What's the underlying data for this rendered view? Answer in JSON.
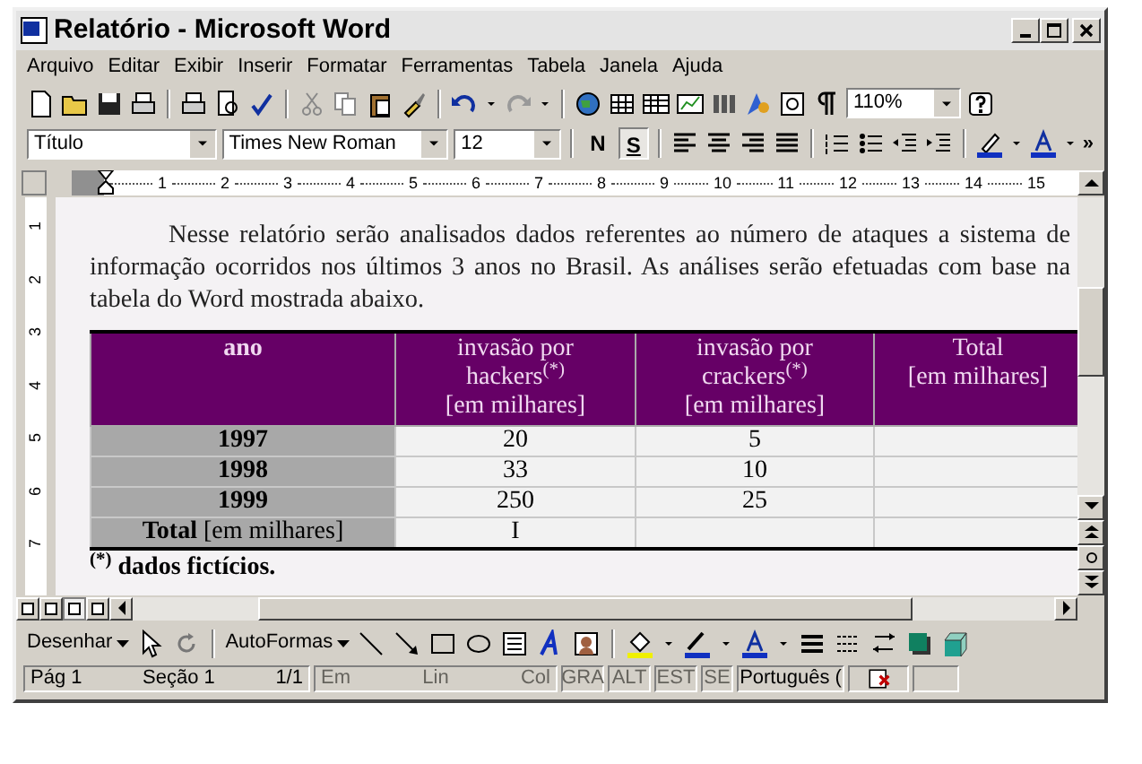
{
  "window": {
    "title": "Relatório - Microsoft Word"
  },
  "menu": [
    "Arquivo",
    "Editar",
    "Exibir",
    "Inserir",
    "Formatar",
    "Ferramentas",
    "Tabela",
    "Janela",
    "Ajuda"
  ],
  "standard_toolbar": {
    "zoom": "110%"
  },
  "formatting_toolbar": {
    "style": "Título",
    "font": "Times New Roman",
    "size": "12",
    "bold": "N",
    "underline": "S",
    "more": "»"
  },
  "ruler": {
    "marks": [
      "1",
      "2",
      "3",
      "4",
      "5",
      "6",
      "7",
      "8",
      "9",
      "10",
      "11",
      "12",
      "13",
      "14",
      "15"
    ]
  },
  "vertical_ruler": {
    "marks": [
      "1",
      "2",
      "3",
      "4",
      "5",
      "6",
      "7"
    ]
  },
  "document": {
    "paragraph": "Nesse relatório serão analisados dados referentes ao número de ataques a sistema de informação ocorridos nos últimos 3 anos no Brasil. As análises serão efetuadas com base na tabela do Word mostrada abaixo.",
    "table": {
      "columns": [
        "ano",
        "invasão por\nhackers$^{(*)}$\n[em milhares]",
        "invasão por\ncrackers$^{(*)}$\n[em milhares]",
        "Total\n[em milhares]"
      ],
      "rows": [
        [
          "1997",
          "20",
          "5",
          ""
        ],
        [
          "1998",
          "33",
          "10",
          ""
        ],
        [
          "1999",
          "250",
          "25",
          ""
        ],
        [
          "**Total** [em milhares]",
          "I",
          "",
          ""
        ]
      ]
    },
    "footnote": "$^{(*)}$ dados fictícios."
  },
  "drawing_toolbar": {
    "draw": "Desenhar",
    "autoshapes": "AutoFormas"
  },
  "status_bar": [
    {
      "text": "Pág 1",
      "disabled": false
    },
    {
      "text": "Seção 1",
      "disabled": false
    },
    {
      "text": "1/1",
      "disabled": false
    },
    {
      "text": "Em",
      "disabled": true
    },
    {
      "text": "Lin",
      "disabled": true
    },
    {
      "text": "Col",
      "disabled": true
    },
    {
      "text": "GRA",
      "disabled": true
    },
    {
      "text": "ALT",
      "disabled": true
    },
    {
      "text": "EST",
      "disabled": true
    },
    {
      "text": "SE",
      "disabled": true
    },
    {
      "text": "Português (",
      "disabled": false
    }
  ]
}
